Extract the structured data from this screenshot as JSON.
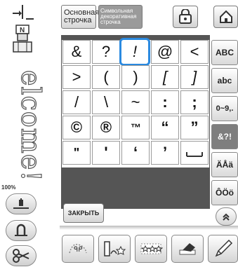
{
  "tabs": {
    "basic_line1": "Основная",
    "basic_line2": "строчка",
    "decor_line1": "Символьная",
    "decor_line2": "декоративная",
    "decor_line3": "строчка"
  },
  "left": {
    "brand": "elcome!",
    "zoom": "100%"
  },
  "grid": {
    "row1": [
      "&",
      "?",
      "!",
      "@",
      "<"
    ],
    "row2": [
      ">",
      "(",
      ")",
      "[",
      "]"
    ],
    "row3": [
      "/",
      "\\",
      "~",
      ":",
      ";"
    ],
    "row4": [
      "©",
      "®",
      "™",
      "“",
      "”"
    ],
    "row5": [
      "\"",
      "'",
      "‘",
      "’",
      ""
    ],
    "selected": "!"
  },
  "char_sets": [
    "ABC",
    "abc",
    "0~9,.",
    "&?!",
    "ÄÅä",
    "ÔÖö"
  ],
  "active_char_set": "&?!",
  "close_label": "ЗАКРЫТЬ",
  "icons": {
    "needle": "needle-position-icon",
    "foot": "presser-foot-n-icon",
    "lock": "lock-icon",
    "home": "home-icon",
    "scroll": "chevron-up-icon",
    "thread": "thread-cut-icon",
    "foot_lift": "presser-foot-lift-icon",
    "scissors": "scissors-icon",
    "curve": "curved-text-icon",
    "letters": "letter-size-icon",
    "pattern": "stitch-pattern-icon",
    "eraser": "eraser-icon",
    "pencil": "pencil-icon"
  },
  "colors": {
    "selection": "#2b8ae0",
    "panel_dark": "#555555",
    "tab_active": "#7e7e7e"
  }
}
